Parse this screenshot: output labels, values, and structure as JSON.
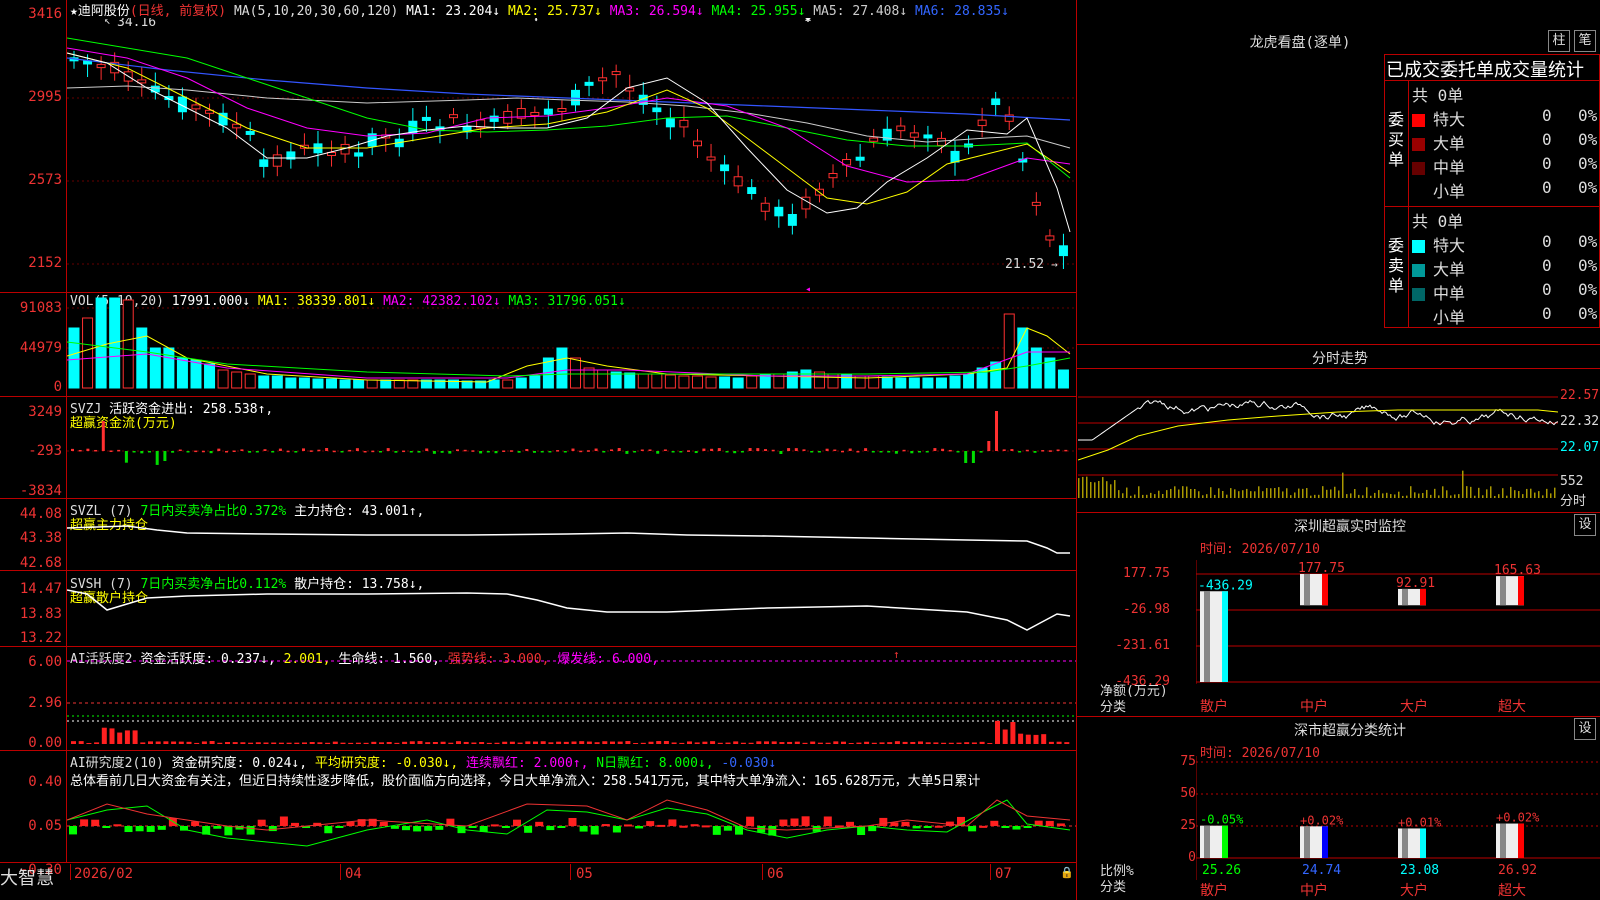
{
  "main": {
    "title": "★迪阿股份",
    "period": "(日线, 前复权)",
    "ma_label": "MA(5,10,20,30,60,120)",
    "ma": [
      {
        "name": "MA1",
        "value": "23.204↓",
        "color": "#ffffff"
      },
      {
        "name": "MA2",
        "value": "25.737↓",
        "color": "#ffff00"
      },
      {
        "name": "MA3",
        "value": "26.594↓",
        "color": "#ff00ff"
      },
      {
        "name": "MA4",
        "value": "25.955↓",
        "color": "#00ff00"
      },
      {
        "name": "MA5",
        "value": "27.408↓",
        "color": "#cccccc"
      },
      {
        "name": "MA6",
        "value": "28.835↓",
        "color": "#3355ff"
      }
    ],
    "y_ticks": [
      "3416",
      "2995",
      "2573",
      "2152"
    ],
    "high_label": "34.16",
    "low_label": "21.52"
  },
  "vol": {
    "label": "VOL(5,10,20)",
    "value": "17991.000↓",
    "ma": [
      {
        "name": "MA1",
        "value": "38339.801↓",
        "color": "#ffff00"
      },
      {
        "name": "MA2",
        "value": "42382.102↓",
        "color": "#ff00ff"
      },
      {
        "name": "MA3",
        "value": "31796.051↓",
        "color": "#00ff00"
      }
    ],
    "y_ticks": [
      "91083",
      "44979",
      "0"
    ]
  },
  "svzj": {
    "label": "SVZJ",
    "desc": "活跃资金进出: 258.538↑,",
    "sub": "超赢资金流(万元)",
    "y_ticks": [
      "3249",
      "-293",
      "-3834"
    ]
  },
  "svzl": {
    "label": "SVZL (7)",
    "desc1": "7日内买卖净占比0.372%",
    "desc2": "主力持仓: 43.001↑,",
    "sub": "超赢主力持仓",
    "y_ticks": [
      "44.08",
      "43.38",
      "42.68"
    ]
  },
  "svsh": {
    "label": "SVSH (7)",
    "desc1": "7日内买卖净占比0.112%",
    "desc2": "散户持仓: 13.758↓,",
    "sub": "超赢散户持仓",
    "y_ticks": [
      "14.47",
      "13.83",
      "13.22"
    ]
  },
  "ai2": {
    "label": "AI活跃度2",
    "desc": "资金活跃度: 0.237↓,",
    "v2": "2.001,",
    "life": "生命线: 1.560,",
    "strong": "强势线: 3.000,",
    "burst": "爆发线: 6.000,",
    "y_ticks": [
      "6.00",
      "2.96",
      "0.00"
    ]
  },
  "ai3": {
    "label": "AI研究度2(10)",
    "desc": "资金研究度: 0.024↓,",
    "avg": "平均研究度: -0.030↓,",
    "cont": "连续飘红: 2.000↑,",
    "nday": "N日飘红: 8.000↓,",
    "last": "-0.030↓",
    "summary": "总体看前几日大资金有关注，但近日持续性逐步降低，股价面临方向选择，今日大单净流入：258.541万元，其中特大单净流入：165.628万元，大单5日累计",
    "y_ticks": [
      "0.40",
      "0.05",
      "-0.30"
    ]
  },
  "xaxis": {
    "labels": [
      "2026/02",
      "04",
      "05",
      "06",
      "07"
    ],
    "brand": "大智慧"
  },
  "dragon": {
    "title": "龙虎看盘(逐单)",
    "btn_bar": "柱",
    "btn_list": "笔",
    "header": "已成交委托单成交量统计",
    "buy_label": "委买单",
    "sell_label": "委卖单",
    "buy_total": "共 0单",
    "sell_total": "共 0单",
    "buy_rows": [
      {
        "name": "特大",
        "count": "0",
        "pct": "0%",
        "color": "#ff0000"
      },
      {
        "name": "大单",
        "count": "0",
        "pct": "0%",
        "color": "#990000"
      },
      {
        "name": "中单",
        "count": "0",
        "pct": "0%",
        "color": "#660000"
      },
      {
        "name": "小单",
        "count": "0",
        "pct": "0%",
        "color": "#000000"
      }
    ],
    "sell_rows": [
      {
        "name": "特大",
        "count": "0",
        "pct": "0%",
        "color": "#00ffff"
      },
      {
        "name": "大单",
        "count": "0",
        "pct": "0%",
        "color": "#009999"
      },
      {
        "name": "中单",
        "count": "0",
        "pct": "0%",
        "color": "#006666"
      },
      {
        "name": "小单",
        "count": "0",
        "pct": "0%",
        "color": "#000000"
      }
    ]
  },
  "intraday": {
    "title": "分时走势",
    "y_ticks": [
      "22.57",
      "22.32",
      "22.07"
    ],
    "vol_label": "552",
    "vol_unit": "分时"
  },
  "monitor": {
    "title": "深圳超赢实时监控",
    "btn": "设",
    "time": "时间: 2026/07/10",
    "y_ticks": [
      "177.75",
      "-26.98",
      "-231.61",
      "-436.29"
    ],
    "net_label": "净额(万元)",
    "cat_label": "分类",
    "bars": [
      {
        "name": "散户",
        "value": "-436.29",
        "color": "#00ffff"
      },
      {
        "name": "中户",
        "value": "177.75",
        "color": "#ff0000"
      },
      {
        "name": "大户",
        "value": "92.91",
        "color": "#ff0000"
      },
      {
        "name": "超大",
        "value": "165.63",
        "color": "#ff0000"
      }
    ]
  },
  "classify": {
    "title": "深市超赢分类统计",
    "btn": "设",
    "time": "时间: 2026/07/10",
    "y_ticks": [
      "75",
      "50",
      "25",
      "0"
    ],
    "ratio_label": "比例%",
    "cat_label": "分类",
    "bars": [
      {
        "name": "散户",
        "top": "-0.05%",
        "value": "25.26",
        "color": "#00ff00"
      },
      {
        "name": "中户",
        "top": "+0.02%",
        "value": "24.74",
        "color": "#0000ff"
      },
      {
        "name": "大户",
        "top": "+0.01%",
        "value": "23.08",
        "color": "#00ffff"
      },
      {
        "name": "超大",
        "top": "+0.02%",
        "value": "26.92",
        "color": "#ff0000"
      }
    ]
  }
}
